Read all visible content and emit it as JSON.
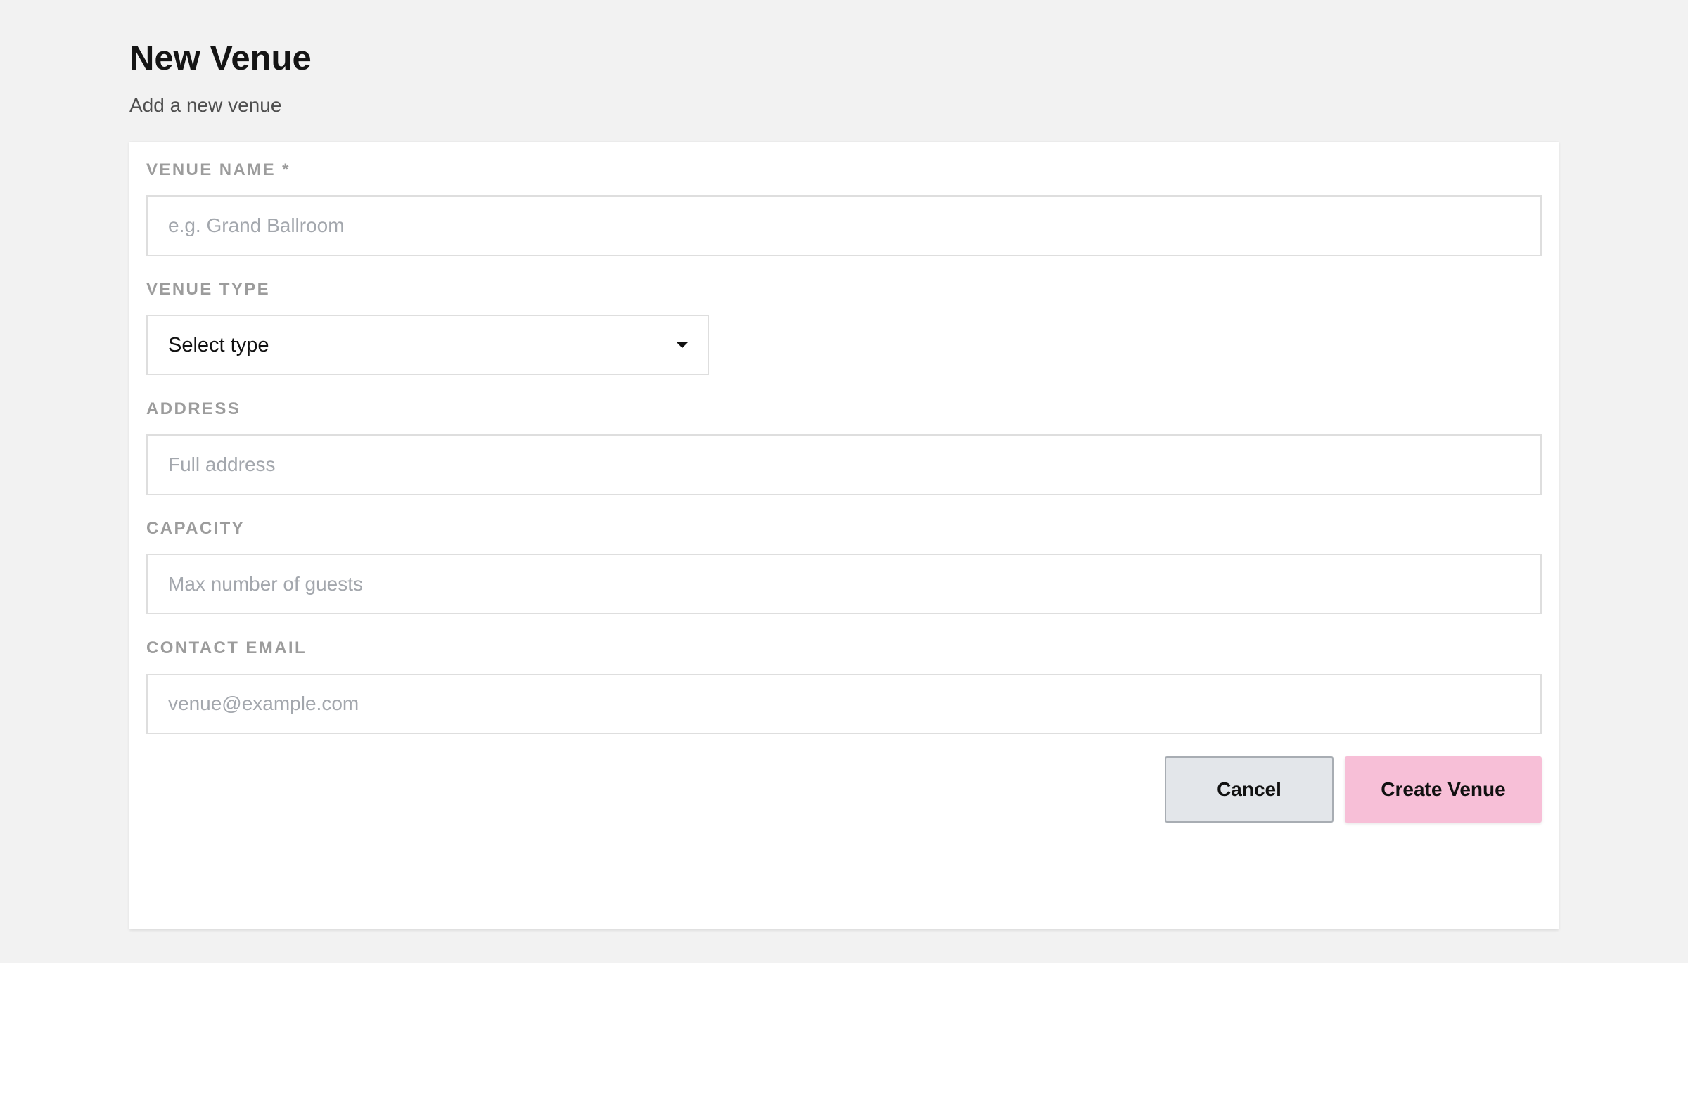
{
  "header": {
    "title": "New Venue",
    "subtitle": "Add a new venue"
  },
  "form": {
    "venue_name": {
      "label": "VENUE NAME *",
      "value": "",
      "placeholder": "e.g. Grand Ballroom"
    },
    "venue_type": {
      "label": "VENUE TYPE",
      "selected": "Select type",
      "icon": "caret-down-icon"
    },
    "address": {
      "label": "ADDRESS",
      "value": "",
      "placeholder": "Full address"
    },
    "capacity": {
      "label": "CAPACITY",
      "value": "",
      "placeholder": "Max number of guests"
    },
    "contact_email": {
      "label": "CONTACT EMAIL",
      "value": "",
      "placeholder": "venue@example.com"
    }
  },
  "actions": {
    "cancel_label": "Cancel",
    "create_label": "Create Venue"
  },
  "colors": {
    "page_background": "#f2f2f2",
    "card_background": "#ffffff",
    "primary_button": "#f7bfd7",
    "secondary_button": "#e3e6ea",
    "label_text": "#9c9c9c"
  }
}
